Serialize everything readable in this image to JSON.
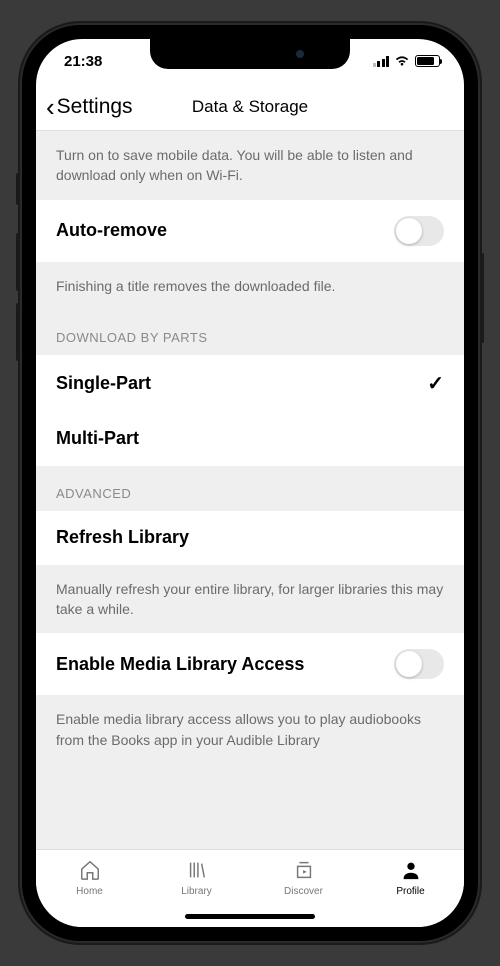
{
  "status": {
    "time": "21:38"
  },
  "nav": {
    "back_label": "Settings",
    "title": "Data & Storage"
  },
  "wifi_desc": "Turn on to save mobile data. You will be able to listen and download only when on Wi-Fi.",
  "auto_remove": {
    "label": "Auto-remove",
    "desc": "Finishing a title removes the downloaded file.",
    "on": false
  },
  "download_parts": {
    "header": "DOWNLOAD BY PARTS",
    "options": [
      {
        "label": "Single-Part",
        "selected": true
      },
      {
        "label": "Multi-Part",
        "selected": false
      }
    ]
  },
  "advanced": {
    "header": "ADVANCED",
    "refresh": {
      "label": "Refresh Library",
      "desc": "Manually refresh your entire library, for larger libraries this may take a while."
    },
    "media_access": {
      "label": "Enable Media Library Access",
      "desc": "Enable media library access allows you to play audiobooks from the Books app in your Audible Library",
      "on": false
    }
  },
  "tabs": [
    {
      "label": "Home"
    },
    {
      "label": "Library"
    },
    {
      "label": "Discover"
    },
    {
      "label": "Profile"
    }
  ]
}
